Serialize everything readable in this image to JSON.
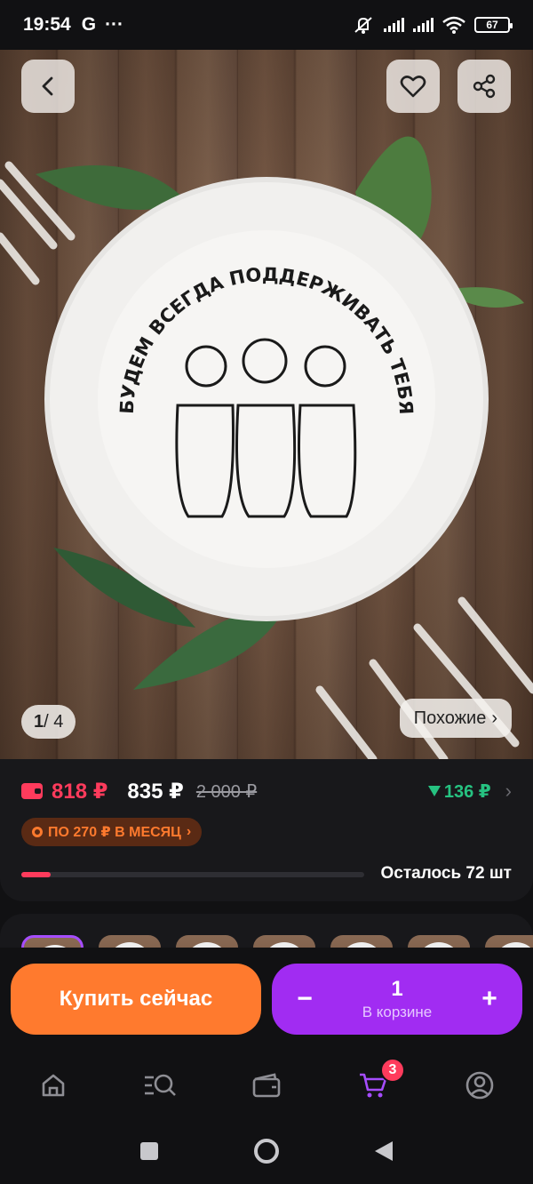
{
  "status_bar": {
    "time": "19:54",
    "g_label": "G",
    "more": "···",
    "battery": "67"
  },
  "hero": {
    "plate_text": "БУДЕМ ВСЕГДА ПОДДЕРЖИВАТЬ ТЕБЯ",
    "page_current": "1",
    "page_total": "/ 4",
    "similar_label": "Похожие",
    "similar_chevron": "›"
  },
  "price": {
    "card_price": "818 ₽",
    "price": "835 ₽",
    "old_price": "2 000 ₽",
    "cashback": "136 ₽",
    "installment": "ПО 270 ₽ В МЕСЯЦ",
    "installment_chevron": "›",
    "stock_label": "Осталось 72 шт",
    "stock_fraction": 0.085
  },
  "variants": {
    "count": 7,
    "selected_index": 0
  },
  "buy": {
    "buy_now": "Купить сейчас",
    "minus": "−",
    "qty": "1",
    "in_cart": "В корзине",
    "plus": "+"
  },
  "nav": {
    "cart_badge": "3"
  },
  "colors": {
    "accent_purple": "#a12cf2",
    "accent_orange": "#ff7a2e",
    "sale_red": "#ff3b5c",
    "cashback_green": "#26c281"
  },
  "icons": [
    "back-icon",
    "heart-icon",
    "share-icon",
    "home-icon",
    "catalog-search-icon",
    "wallet-icon",
    "cart-icon",
    "profile-icon"
  ]
}
